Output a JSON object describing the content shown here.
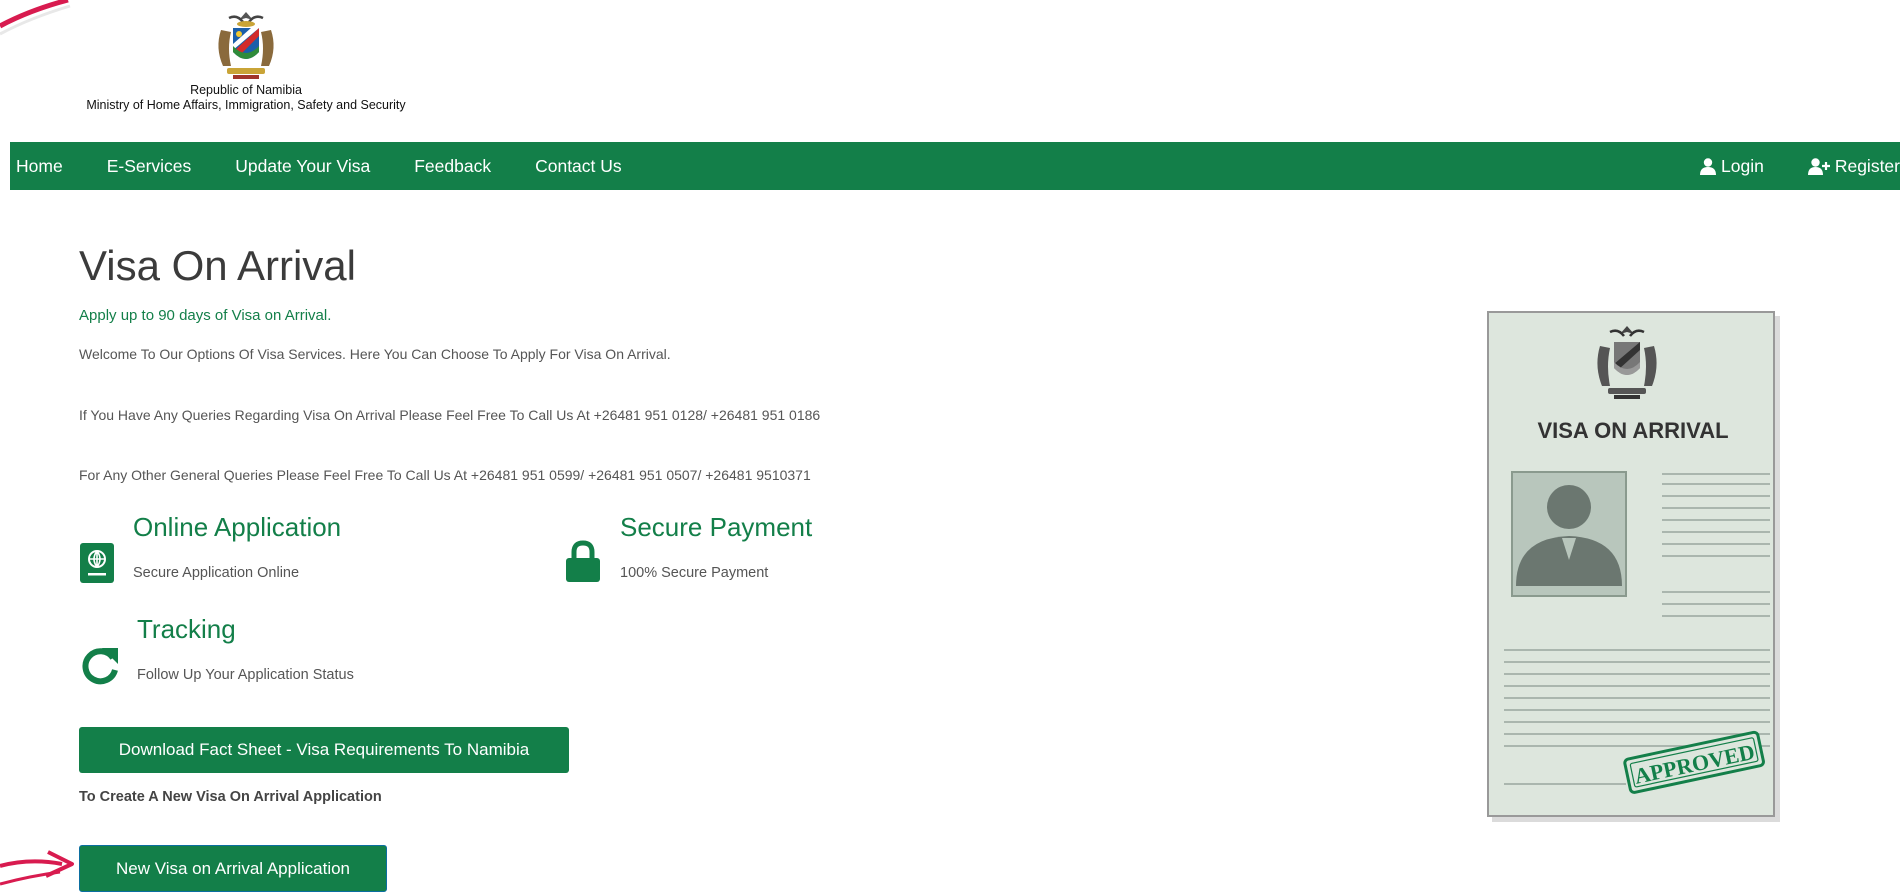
{
  "colors": {
    "brand_green": "#137f49",
    "swoosh_red": "#d81b4f"
  },
  "header": {
    "logo_title": "Republic of Namibia",
    "ministry": "Ministry of Home Affairs, Immigration, Safety and Security"
  },
  "nav": {
    "items": [
      "Home",
      "E-Services",
      "Update Your Visa",
      "Feedback",
      "Contact Us"
    ],
    "login": "Login",
    "register": "Register"
  },
  "main": {
    "title": "Visa On Arrival",
    "subtitle": "Apply up to 90 days of Visa on Arrival.",
    "welcome": "Welcome To Our Options Of Visa Services. Here You Can Choose To Apply For Visa On Arrival.",
    "queries_voa": "If You Have Any Queries Regarding Visa On Arrival Please Feel Free To Call Us At +26481 951 0128/ +26481 951 0186",
    "queries_general": "For Any Other General Queries Please Feel Free To Call Us At +26481 951 0599/ +26481 951 0507/ +26481 9510371",
    "features": [
      {
        "title": "Online Application",
        "desc": "Secure Application Online",
        "icon": "passport-icon"
      },
      {
        "title": "Secure Payment",
        "desc": "100% Secure Payment",
        "icon": "lock-icon"
      },
      {
        "title": "Tracking",
        "desc": "Follow Up Your Application Status",
        "icon": "refresh-icon"
      }
    ],
    "download_btn": "Download Fact Sheet - Visa Requirements To Namibia",
    "create_label": "To Create A New Visa On Arrival Application",
    "new_btn": "New Visa on Arrival Application"
  },
  "visa_card": {
    "heading": "VISA ON ARRIVAL",
    "stamp": "APPROVED"
  }
}
